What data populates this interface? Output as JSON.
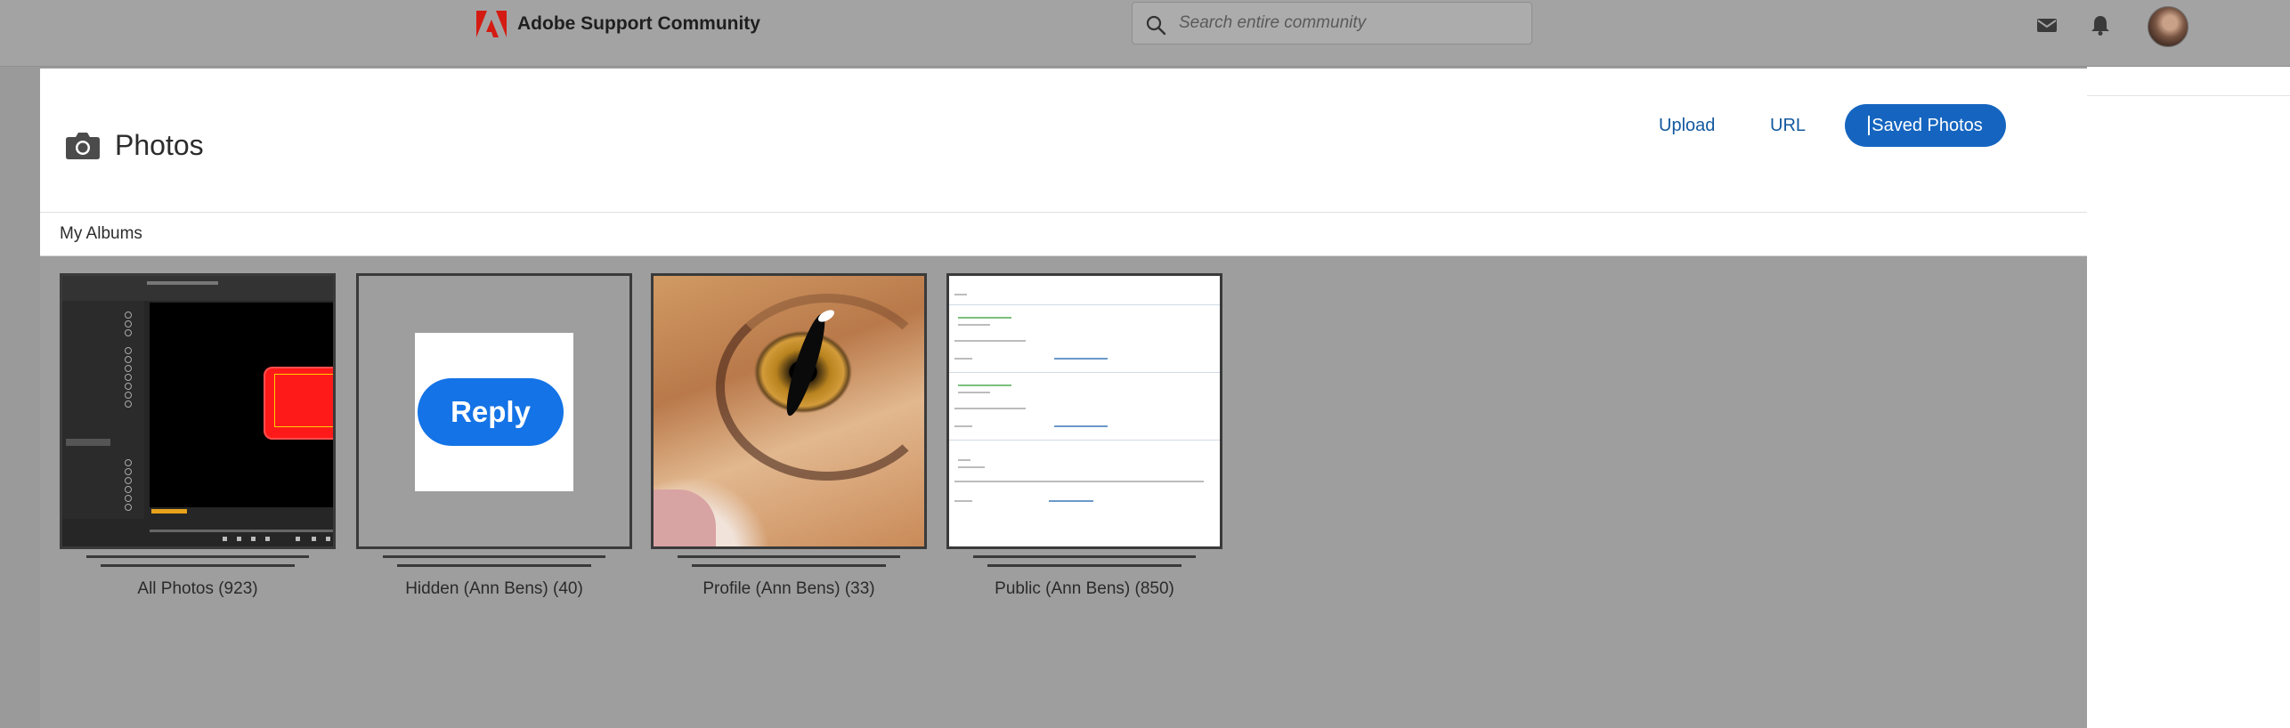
{
  "header": {
    "brand": "Adobe Support Community",
    "search_placeholder": "Search entire community",
    "icons": [
      "mail-icon",
      "bell-icon",
      "avatar"
    ]
  },
  "modal": {
    "title": "Photos",
    "tabs": {
      "upload": "Upload",
      "url": "URL",
      "saved": "Saved Photos"
    },
    "active_tab": "saved",
    "albums_label": "My Albums",
    "albums": [
      {
        "name": "All Photos (923)",
        "thumb": "video-editor-screenshot"
      },
      {
        "name": "Hidden (Ann Bens) (40)",
        "thumb": "reply-button-image"
      },
      {
        "name": "Profile (Ann Bens) (33)",
        "thumb": "cat-eye-photo"
      },
      {
        "name": "Public (Ann Bens) (850)",
        "thumb": "forum-page-screenshot"
      }
    ],
    "reply_thumb_text": "Reply"
  },
  "colors": {
    "accent": "#1565c0",
    "link": "#12589e",
    "overlay": "#9e9e9e",
    "adobe_red": "#eb1000"
  }
}
